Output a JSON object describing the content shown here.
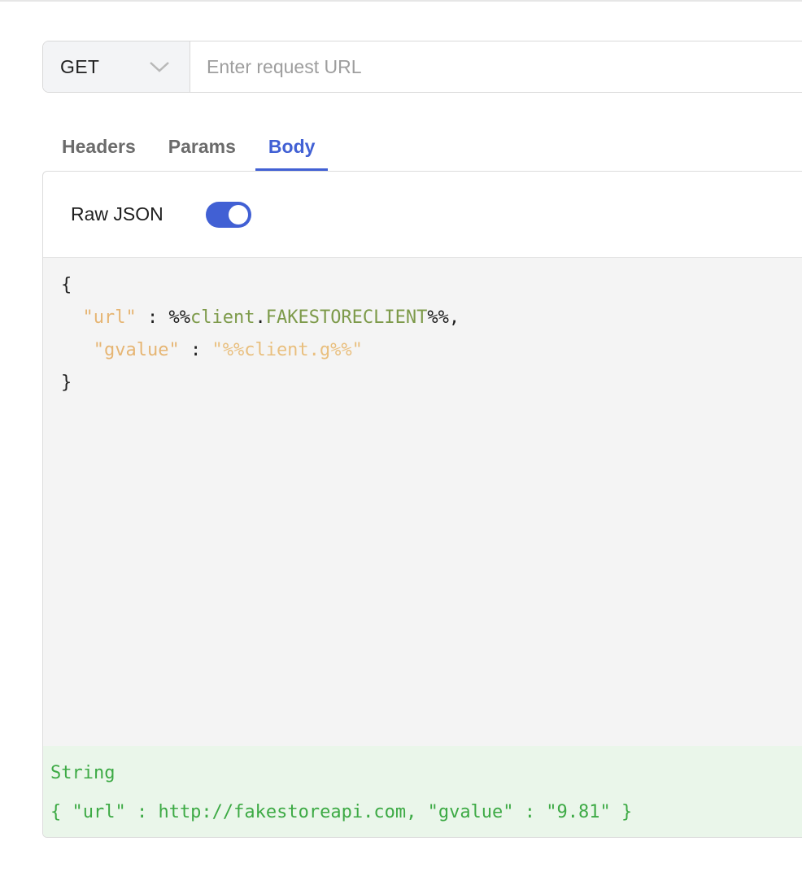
{
  "request": {
    "method": "GET",
    "url_value": "",
    "url_placeholder": "Enter request URL"
  },
  "tabs": [
    {
      "label": "Headers",
      "active": false
    },
    {
      "label": "Params",
      "active": false
    },
    {
      "label": "Body",
      "active": true
    }
  ],
  "body": {
    "raw_json_label": "Raw JSON",
    "raw_json_enabled": true,
    "code": {
      "open_brace": "{",
      "line1": {
        "indent": "  ",
        "key": "\"url\"",
        "sep": " : ",
        "var_prefix": "%%",
        "var_scope": "client",
        "var_dot": ".",
        "var_name": "FAKESTORECLIENT",
        "var_suffix": "%%",
        "trail": ","
      },
      "line2": {
        "indent": "   ",
        "key": "\"gvalue\"",
        "sep": " : ",
        "value": "\"%%client.g%%\""
      },
      "close_brace": "}"
    }
  },
  "result": {
    "type_label": "String",
    "value": "{ \"url\" : http://fakestoreapi.com, \"gvalue\" : \"9.81\" }"
  },
  "colors": {
    "accent": "#4160d4",
    "json_key": "#e6b573",
    "variable": "#7d9a4a",
    "result_text": "#3daa45",
    "result_bg": "#eaf6ea"
  }
}
